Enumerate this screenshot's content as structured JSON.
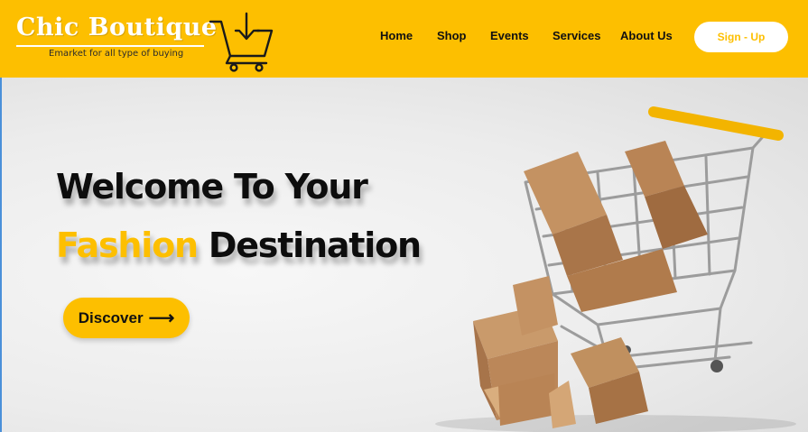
{
  "brand": {
    "name": "Chic Boutique",
    "tagline": "Emarket for all type of buying"
  },
  "nav": {
    "items": [
      "Home",
      "Shop",
      "Events",
      "Services",
      "About Us"
    ],
    "signup_label": "Sign - Up"
  },
  "hero": {
    "line1": "Welcome To Your",
    "line2_accent": "Fashion",
    "line2_rest": " Destination",
    "cta_label": "Discover",
    "cta_arrow": "⟶"
  },
  "icons": {
    "logo": "shopping-cart-download-icon",
    "cta_arrow": "long-arrow-right-icon",
    "hero_image": "shopping-cart-with-boxes"
  },
  "colors": {
    "accent": "#fdbf00",
    "text_dark": "#0d0d0d",
    "white": "#ffffff"
  }
}
